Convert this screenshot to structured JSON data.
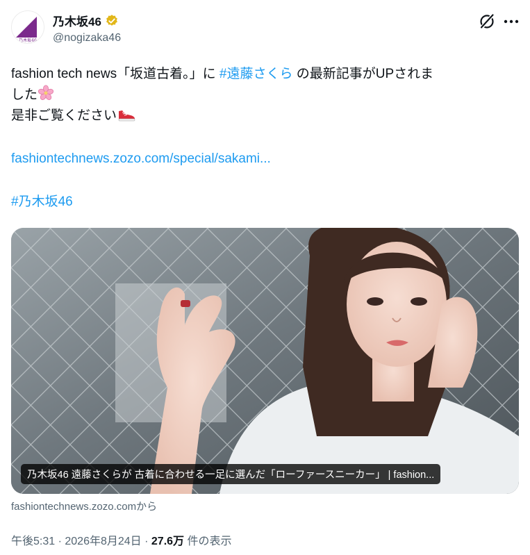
{
  "author": {
    "name": "乃木坂46",
    "handle": "@nogizaka46",
    "avatar_text": "乃木坂46",
    "verified": true
  },
  "tweet": {
    "line1_pre": "fashion tech news「坂道古着。」に ",
    "line1_hashtag": "#遠藤さくら",
    "line1_post": " の最新記事がUPされま",
    "line2": "した",
    "line2_emoji": "cherry-blossom",
    "line3": "是非ご覧ください",
    "line3_emoji": "sneaker",
    "url": "fashiontechnews.zozo.com/special/sakami...",
    "hashtag2": "#乃木坂46"
  },
  "card": {
    "caption": "乃木坂46 遠藤さくらが 古着に合わせる一足に選んだ「ローファースニーカー」 | fashion...",
    "source": "fashiontechnews.zozo.comから"
  },
  "meta": {
    "time": "午後5:31",
    "separator": " · ",
    "date": "2026年8月24日",
    "views": "27.6万",
    "views_label": " 件の表示"
  },
  "colors": {
    "accent": "#1d9bf0",
    "text": "#0f1419",
    "secondary": "#536471",
    "verified": "#e2b719",
    "brand_purple": "#7b2a8c"
  },
  "icons": [
    "verified-badge-icon",
    "grok-icon",
    "more-options-icon",
    "cherry-blossom-emoji",
    "sneaker-emoji"
  ]
}
